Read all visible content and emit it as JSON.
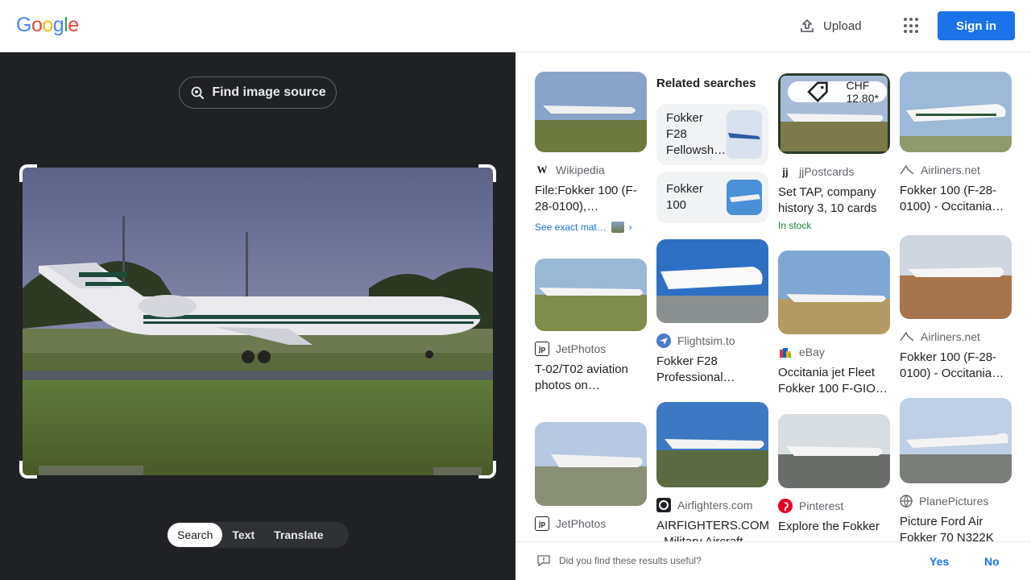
{
  "header": {
    "logo": [
      "G",
      "o",
      "o",
      "g",
      "l",
      "e"
    ],
    "logo_colors": [
      "#4285f4",
      "#ea4335",
      "#fbbc05",
      "#4285f4",
      "#34a853",
      "#ea4335"
    ],
    "upload_label": "Upload",
    "signin_label": "Sign in"
  },
  "left": {
    "find_source_label": "Find image source",
    "modes": [
      {
        "label": "Search",
        "active": true
      },
      {
        "label": "Text",
        "active": false
      },
      {
        "label": "Translate",
        "active": false
      }
    ]
  },
  "results": {
    "related_heading": "Related searches",
    "related": [
      {
        "label": "Fokker F28 Fellowsh…"
      },
      {
        "label": "Fokker 100"
      }
    ],
    "col1": [
      {
        "source": "Wikipedia",
        "favicon": "W",
        "title": "File:Fokker 100 (F-28-0100),…",
        "extra": "See exact mat…"
      },
      {
        "source": "JetPhotos",
        "favicon": "jp",
        "title": "T-02/T02 aviation photos on…"
      },
      {
        "source": "JetPhotos",
        "favicon": "jp",
        "title": ""
      }
    ],
    "col2": [
      {
        "source": "Flightsim.to",
        "title": "Fokker F28 Professional…"
      },
      {
        "source": "Airfighters.com",
        "title": "AIRFIGHTERS.COM - Military Aircraft"
      }
    ],
    "col3": [
      {
        "source": "jjPostcards",
        "favicon": "jj",
        "title": "Set TAP, company history 3, 10 cards",
        "price": "CHF 12.80*",
        "stock": "In stock"
      },
      {
        "source": "eBay",
        "title": "Occitania jet Fleet Fokker 100 F-GIO…"
      },
      {
        "source": "Pinterest",
        "title": "Explore the Fokker"
      }
    ],
    "col4": [
      {
        "source": "Airliners.net",
        "title": "Fokker 100 (F-28-0100) - Occitania…"
      },
      {
        "source": "Airliners.net",
        "title": "Fokker 100 (F-28-0100) - Occitania…"
      },
      {
        "source": "PlanePictures",
        "title": "Picture Ford Air Fokker 70 N322K"
      }
    ]
  },
  "feedback": {
    "question": "Did you find these results useful?",
    "yes": "Yes",
    "no": "No"
  }
}
